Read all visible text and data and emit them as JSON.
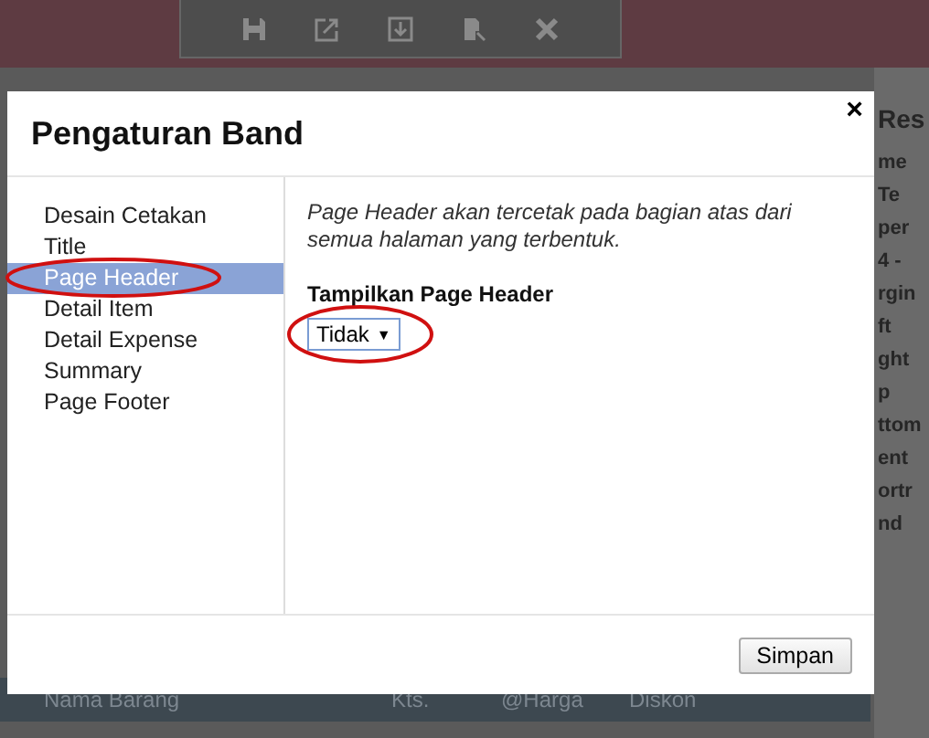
{
  "background": {
    "side_panel": [
      "Res",
      "me",
      "Te",
      "per",
      "4 -",
      "rgin",
      "ft",
      "ght",
      "p",
      "ttom",
      "ent",
      "ortr",
      "nd"
    ],
    "table_columns": [
      "Nama Barang",
      "Kts.",
      "@Harga",
      "Diskon"
    ]
  },
  "dialog": {
    "title": "Pengaturan Band",
    "close": "×",
    "items": [
      {
        "label": "Desain Cetakan",
        "selected": false
      },
      {
        "label": "Title",
        "selected": false
      },
      {
        "label": "Page Header",
        "selected": true
      },
      {
        "label": "Detail Item",
        "selected": false
      },
      {
        "label": "Detail Expense",
        "selected": false
      },
      {
        "label": "Summary",
        "selected": false
      },
      {
        "label": "Page Footer",
        "selected": false
      }
    ],
    "description": "Page Header akan tercetak pada bagian atas dari semua halaman yang terbentuk.",
    "field_label": "Tampilkan Page Header",
    "select_value": "Tidak",
    "select_arrow": "▼",
    "save": "Simpan"
  }
}
